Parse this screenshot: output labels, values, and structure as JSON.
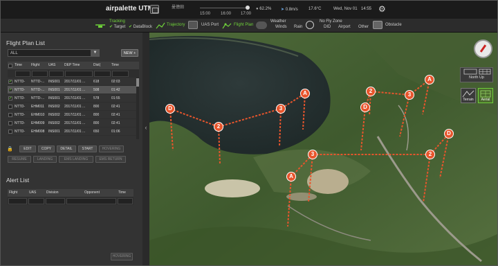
{
  "app": {
    "title": "airpalette UTM"
  },
  "timeline": {
    "label": "曼徳田",
    "ticks": [
      "15:00",
      "16:00",
      "17:00"
    ]
  },
  "weather_status": {
    "humidity": "62.2%",
    "wind": "0.8m/s",
    "temperature": "17.6°C"
  },
  "datetime": {
    "date": "Wed, Nov 01",
    "time": "14:55"
  },
  "toolbar": {
    "tracking": "Tracking",
    "target": "Target",
    "datablock": "DataBlock",
    "trajectory": "Trajectory",
    "uas_port": "UAS Port",
    "flight_plan": "Flight Plan",
    "weather_label": "Weather",
    "winds": "Winds",
    "rain": "Rain",
    "no_fly_zone": "No Fly Zone",
    "did": "DID",
    "airport": "Airport",
    "other": "Other",
    "obstacle": "Obstacle"
  },
  "flight_plan": {
    "title": "Flight Plan List",
    "filter": "ALL",
    "new_btn": "NEW +",
    "columns": [
      "Time",
      "Flight",
      "UAS",
      "DEP Time",
      "Dist(",
      "Time"
    ],
    "rows": [
      {
        "checked": true,
        "time": "NTTD-",
        "flight": "NTTD-...",
        "uas": "INS001",
        "dep": "2017/11/01 ...",
        "dist": "618",
        "dur": "02:03"
      },
      {
        "checked": true,
        "time": "NTTD-",
        "flight": "NTTD-...",
        "uas": "INS001",
        "dep": "2017/11/01 ...",
        "dist": "508",
        "dur": "01:42"
      },
      {
        "checked": true,
        "time": "NTTD-",
        "flight": "NTTD-...",
        "uas": "INS001",
        "dep": "2017/11/01 ...",
        "dist": "578",
        "dur": "01:55"
      },
      {
        "checked": false,
        "time": "NTTD-",
        "flight": "EHM011",
        "uas": "INS002",
        "dep": "2017/11/01 ...",
        "dist": "800",
        "dur": "02:41"
      },
      {
        "checked": false,
        "time": "NTTD-",
        "flight": "EHM010",
        "uas": "INS002",
        "dep": "2017/11/01 ...",
        "dist": "800",
        "dur": "02:41"
      },
      {
        "checked": false,
        "time": "NTTD-",
        "flight": "EHM009",
        "uas": "INS002",
        "dep": "2017/11/01 ...",
        "dist": "800",
        "dur": "02:41"
      },
      {
        "checked": false,
        "time": "NTTD-",
        "flight": "EHM008",
        "uas": "INS001",
        "dep": "2017/11/01 ...",
        "dist": "650",
        "dur": "01:06"
      }
    ],
    "buttons1": [
      "EDIT",
      "COPY",
      "DETAIL",
      "START",
      "HOVERING"
    ],
    "buttons2": [
      "RESUME",
      "LANDING",
      "EMS LANDING",
      "EMS RETURN"
    ]
  },
  "alert": {
    "title": "Alert List",
    "columns": [
      "Flight",
      "UAS",
      "Division",
      "Opponent",
      "Time"
    ],
    "hovering": "HOVERING"
  },
  "map": {
    "north_up": "North Up",
    "terrain": "Terrain",
    "aerial": "Aerial",
    "markers": [
      "A",
      "2",
      "3",
      "D",
      "A",
      "2",
      "3",
      "D",
      "A",
      "3",
      "2",
      "D"
    ]
  }
}
